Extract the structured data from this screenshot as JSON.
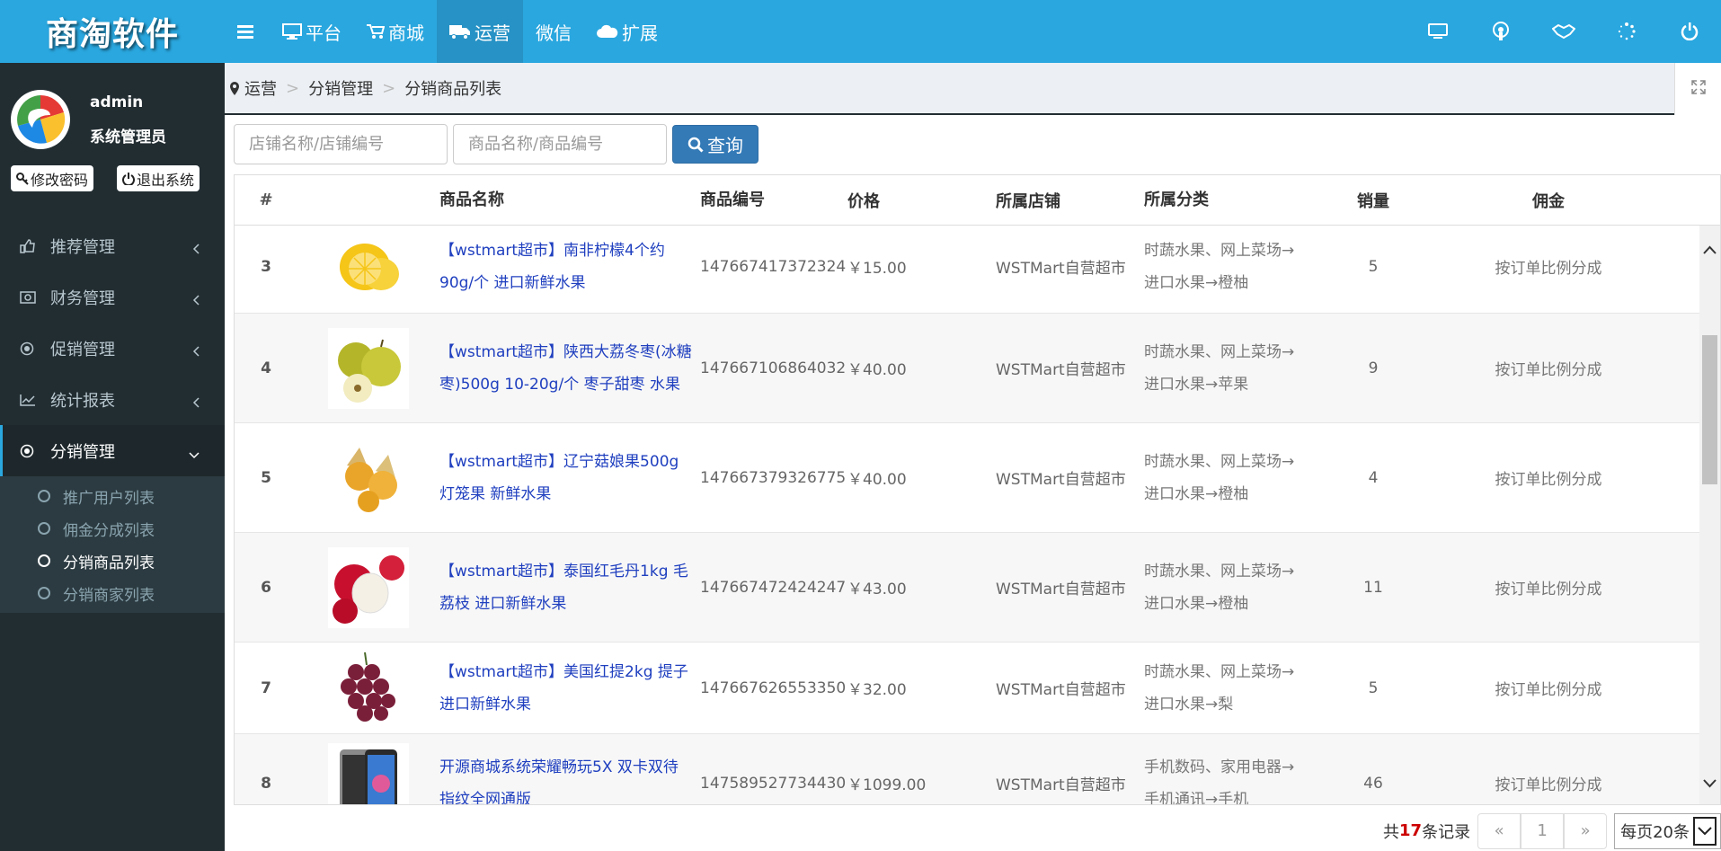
{
  "app": {
    "logo": "商淘软件"
  },
  "topnav": [
    {
      "label": "",
      "icon": "menu-icon"
    },
    {
      "label": "平台",
      "icon": "monitor-icon"
    },
    {
      "label": "商城",
      "icon": "cart-icon"
    },
    {
      "label": "运营",
      "icon": "truck-icon",
      "active": true
    },
    {
      "label": "微信",
      "icon": ""
    },
    {
      "label": "扩展",
      "icon": "cloud-icon"
    }
  ],
  "topright_icons": [
    "desktop-icon",
    "podcast-icon",
    "handshake-icon",
    "spinner-icon",
    "power-icon"
  ],
  "user": {
    "name": "admin",
    "role": "系统管理员",
    "change_pwd": "修改密码",
    "logout": "退出系统"
  },
  "menu": [
    {
      "label": "推荐管理",
      "icon": "thumbs-up-icon"
    },
    {
      "label": "财务管理",
      "icon": "money-icon"
    },
    {
      "label": "促销管理",
      "icon": "bullseye-icon"
    },
    {
      "label": "统计报表",
      "icon": "line-chart-icon"
    },
    {
      "label": "分销管理",
      "icon": "dot-circle-icon",
      "open": true
    }
  ],
  "submenu": [
    {
      "label": "推广用户列表"
    },
    {
      "label": "佣金分成列表"
    },
    {
      "label": "分销商品列表",
      "active": true
    },
    {
      "label": "分销商家列表"
    }
  ],
  "breadcrumb": [
    "运营",
    "分销管理",
    "分销商品列表"
  ],
  "search": {
    "shop_placeholder": "店铺名称/店铺编号",
    "goods_placeholder": "商品名称/商品编号",
    "query": "查询"
  },
  "columns": [
    "#",
    "商品名称",
    "商品编号",
    "价格",
    "所属店铺",
    "所属分类",
    "销量",
    "佣金"
  ],
  "rows": [
    {
      "no": "3",
      "name": "【wstmart超市】南非柠檬4个约90g/个 进口新鲜水果",
      "sn": "147667417372324",
      "price": "￥15.00",
      "shop": "WSTMart自营超市",
      "cat": "时蔬水果、网上菜场→进口水果→橙柚",
      "sales": "5",
      "comm": "按订单比例分成",
      "img": "lemon"
    },
    {
      "no": "4",
      "name": "【wstmart超市】陕西大荔冬枣(冰糖枣)500g 10-20g/个 枣子甜枣 水果",
      "sn": "147667106864032",
      "price": "￥40.00",
      "shop": "WSTMart自营超市",
      "cat": "时蔬水果、网上菜场→进口水果→苹果",
      "sales": "9",
      "comm": "按订单比例分成",
      "img": "jujube"
    },
    {
      "no": "5",
      "name": "【wstmart超市】辽宁菇娘果500g 灯笼果 新鲜水果",
      "sn": "147667379326775",
      "price": "￥40.00",
      "shop": "WSTMart自营超市",
      "cat": "时蔬水果、网上菜场→进口水果→橙柚",
      "sales": "4",
      "comm": "按订单比例分成",
      "img": "physalis"
    },
    {
      "no": "6",
      "name": "【wstmart超市】泰国红毛丹1kg 毛荔枝 进口新鲜水果",
      "sn": "147667472424247",
      "price": "￥43.00",
      "shop": "WSTMart自营超市",
      "cat": "时蔬水果、网上菜场→进口水果→橙柚",
      "sales": "11",
      "comm": "按订单比例分成",
      "img": "rambutan"
    },
    {
      "no": "7",
      "name": "【wstmart超市】美国红提2kg 提子 进口新鲜水果",
      "sn": "147667626553350",
      "price": "￥32.00",
      "shop": "WSTMart自营超市",
      "cat": "时蔬水果、网上菜场→进口水果→梨",
      "sales": "5",
      "comm": "按订单比例分成",
      "img": "grapes"
    },
    {
      "no": "8",
      "name": "开源商城系统荣耀畅玩5X 双卡双待 指纹全网通版",
      "sn": "147589527734430",
      "price": "￥1099.00",
      "shop": "WSTMart自营超市",
      "cat": "手机数码、家用电器→手机通讯→手机",
      "sales": "46",
      "comm": "按订单比例分成",
      "img": "phone"
    }
  ],
  "pager": {
    "total_prefix": "共",
    "total": "17",
    "total_suffix": "条记录",
    "prev": "«",
    "page": "1",
    "next": "»",
    "per_page": "每页20条"
  },
  "colors": {
    "topbar": "#2aa7df",
    "sidebar": "#222d32",
    "link": "#1f3fbf",
    "button": "#337ab7"
  }
}
